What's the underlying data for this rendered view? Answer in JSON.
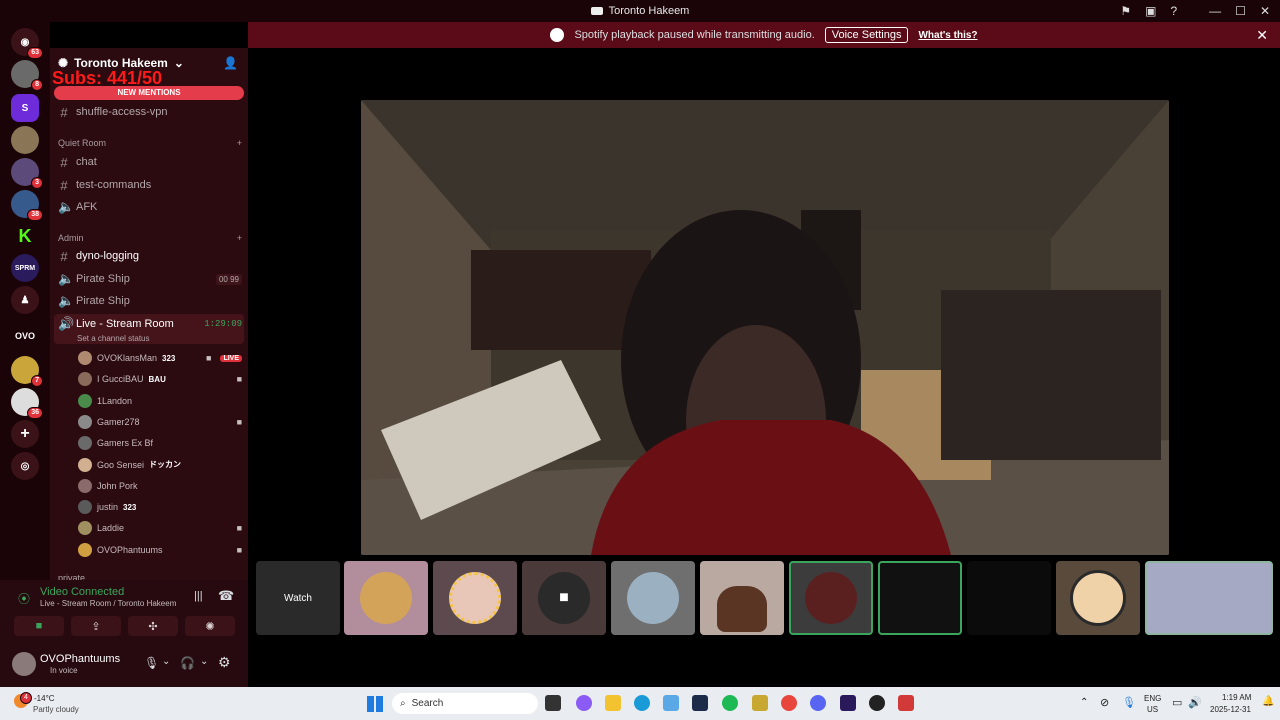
{
  "window": {
    "title": "Toronto Hakeem"
  },
  "banner": {
    "message": "Spotify playback paused while transmitting audio.",
    "button": "Voice Settings",
    "link": "What's this?"
  },
  "rail": {
    "badges": {
      "home": "63",
      "s2": "8",
      "s5": "3",
      "s6": "38",
      "s12": "7",
      "s13": "36"
    }
  },
  "server": {
    "name": "Toronto Hakeem",
    "overlay_text": "Subs: 441/50",
    "new_mentions": "NEW MENTIONS"
  },
  "channels": {
    "top": "shuffle-access-vpn",
    "cat_quiet": "Quiet Room",
    "quiet": [
      "chat",
      "test-commands",
      "AFK"
    ],
    "cat_admin": "Admin",
    "admin": [
      "dyno-logging",
      "Pirate Ship",
      "Pirate Ship"
    ],
    "pirate_counts": [
      "00",
      "99"
    ],
    "live_room": "Live - Stream Room",
    "live_time": "1:29:09",
    "live_status": "Set a channel status",
    "private": "private"
  },
  "voice_users": [
    {
      "name": "OVOKlansMan",
      "extra": "323",
      "live": "LIVE"
    },
    {
      "name": "I GucciBAU",
      "extra": "BAU"
    },
    {
      "name": "1Landon",
      "extra": ""
    },
    {
      "name": "Gamer278",
      "extra": ""
    },
    {
      "name": "Gamers Ex Bf",
      "extra": ""
    },
    {
      "name": "Goo Sensei",
      "extra": "ドッカン"
    },
    {
      "name": "John Pork",
      "extra": ""
    },
    {
      "name": "justin",
      "extra": "323"
    },
    {
      "name": "Laddie",
      "extra": ""
    },
    {
      "name": "OVOPhantuums",
      "extra": ""
    }
  ],
  "voice_panel": {
    "status": "Video Connected",
    "location": "Live - Stream Room / Toronto Hakeem"
  },
  "user_panel": {
    "name": "OVOPhantuums",
    "status": "In voice"
  },
  "tiles": {
    "watch": "Watch"
  },
  "taskbar": {
    "weather_temp": "-14°C",
    "weather_desc": "Partly cloudy",
    "weather_badge": "4",
    "search": "Search",
    "lang1": "ENG",
    "lang2": "US",
    "time": "1:19 AM",
    "date": "2025-12-31"
  }
}
